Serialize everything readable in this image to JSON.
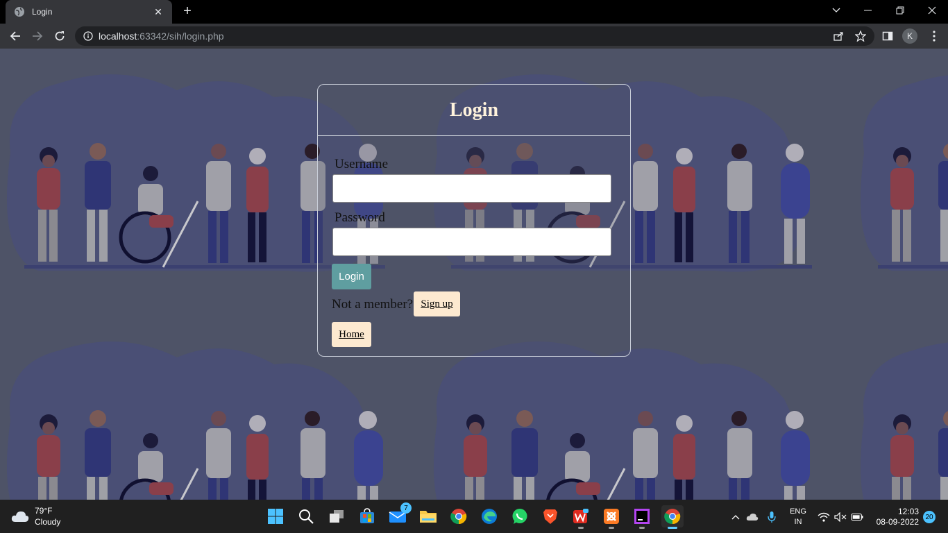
{
  "browser": {
    "tab_title": "Login",
    "new_tab": "+",
    "url_host": "localhost",
    "url_rest": ":63342/sih/login.php",
    "profile_initial": "K"
  },
  "login": {
    "title": "Login",
    "username_label": "Username",
    "username_value": "",
    "password_label": "Password",
    "password_value": "",
    "login_button": "Login",
    "not_member_text": "Not a member?",
    "signup_button": "Sign up",
    "home_button": "Home"
  },
  "taskbar": {
    "weather_temp": "79°F",
    "weather_desc": "Cloudy",
    "mail_badge": "7",
    "lang_top": "ENG",
    "lang_bottom": "IN",
    "time": "12:03",
    "date": "08-09-2022",
    "notifications": "20"
  },
  "colors": {
    "page_bg": "#4e5367",
    "login_button": "#5f9ea0",
    "cream_button": "#fde9d0",
    "title": "#fff3dc"
  }
}
